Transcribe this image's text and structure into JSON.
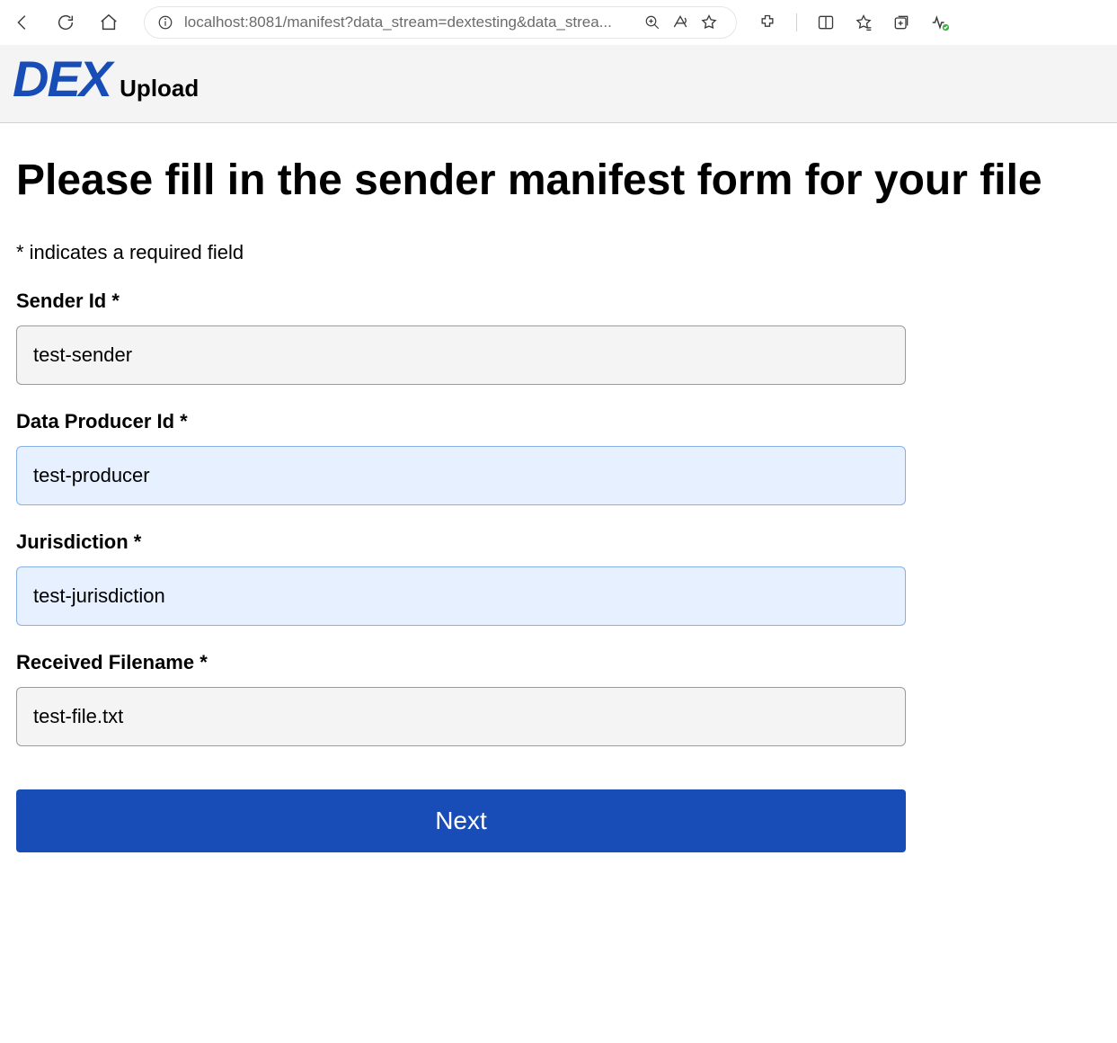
{
  "browser": {
    "url_display": "localhost:8081/manifest?data_stream=dextesting&data_strea..."
  },
  "header": {
    "logo_text": "DEX",
    "subtitle": "Upload"
  },
  "main": {
    "title": "Please fill in the sender manifest form for your file",
    "required_note": "* indicates a required field",
    "fields": [
      {
        "label": "Sender Id *",
        "value": "test-sender",
        "autofill": false
      },
      {
        "label": "Data Producer Id *",
        "value": "test-producer",
        "autofill": true
      },
      {
        "label": "Jurisdiction *",
        "value": "test-jurisdiction",
        "autofill": true
      },
      {
        "label": "Received Filename *",
        "value": "test-file.txt",
        "autofill": false
      }
    ],
    "next_label": "Next"
  }
}
